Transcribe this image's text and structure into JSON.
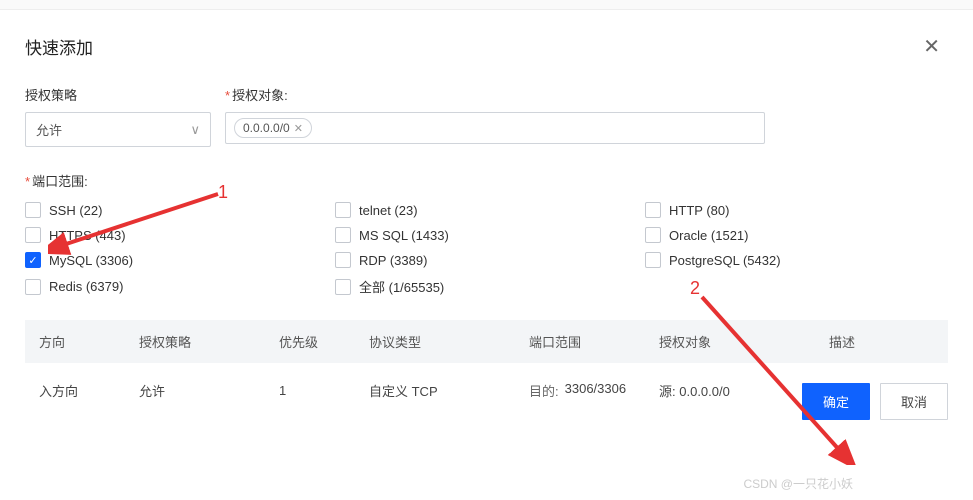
{
  "modal": {
    "title": "快速添加",
    "close": "✕"
  },
  "form": {
    "policy_label": "授权策略",
    "policy_value": "允许",
    "target_label": "授权对象:",
    "target_tag": "0.0.0.0/0",
    "tag_remove": "✕"
  },
  "port_section": {
    "label": "端口范围:",
    "options": [
      {
        "label": "SSH (22)",
        "checked": false
      },
      {
        "label": "telnet (23)",
        "checked": false
      },
      {
        "label": "HTTP (80)",
        "checked": false
      },
      {
        "label": "HTTPS (443)",
        "checked": false
      },
      {
        "label": "MS SQL (1433)",
        "checked": false
      },
      {
        "label": "Oracle (1521)",
        "checked": false
      },
      {
        "label": "MySQL (3306)",
        "checked": true
      },
      {
        "label": "RDP (3389)",
        "checked": false
      },
      {
        "label": "PostgreSQL (5432)",
        "checked": false
      },
      {
        "label": "Redis (6379)",
        "checked": false
      },
      {
        "label": "全部 (1/65535)",
        "checked": false
      }
    ]
  },
  "table": {
    "headers": {
      "direction": "方向",
      "policy": "授权策略",
      "priority": "优先级",
      "protocol": "协议类型",
      "port_range": "端口范围",
      "target": "授权对象",
      "desc": "描述"
    },
    "row": {
      "direction": "入方向",
      "policy": "允许",
      "priority": "1",
      "protocol": "自定义 TCP",
      "port_label": "目的:",
      "port_value": "3306/3306",
      "target_label": "源:",
      "target_value": "0.0.0.0/0",
      "desc": ""
    }
  },
  "footer": {
    "confirm": "确定",
    "cancel": "取消"
  },
  "annotations": {
    "a1": "1",
    "a2": "2"
  },
  "watermark": "CSDN @一只花小妖"
}
